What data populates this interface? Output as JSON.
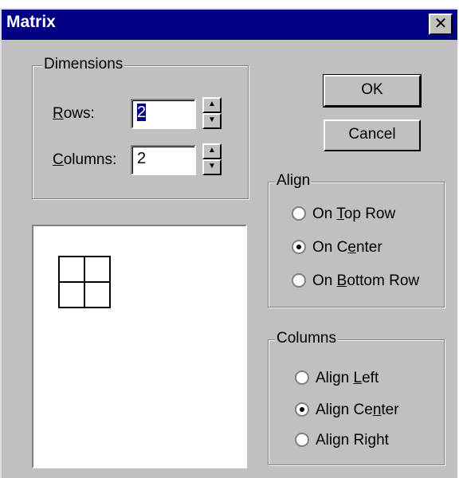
{
  "window": {
    "title": "Matrix",
    "close_glyph": "✕"
  },
  "dimensions": {
    "legend": "Dimensions",
    "rows_label_u": "R",
    "rows_label_rest": "ows:",
    "rows_value": "2",
    "columns_label_u": "C",
    "columns_label_rest": "olumns:",
    "columns_value": "2"
  },
  "buttons": {
    "ok": "OK",
    "cancel": "Cancel"
  },
  "align": {
    "legend": "Align",
    "opt1_pre": "On ",
    "opt1_u": "T",
    "opt1_post": "op Row",
    "opt2_pre": "On C",
    "opt2_u": "e",
    "opt2_post": "nter",
    "opt3_pre": "On ",
    "opt3_u": "B",
    "opt3_post": "ottom Row",
    "selected": "On Center"
  },
  "columns": {
    "legend": "Columns",
    "opt1_pre": "Align ",
    "opt1_u": "L",
    "opt1_post": "eft",
    "opt2_pre": "Align Ce",
    "opt2_u": "n",
    "opt2_post": "ter",
    "opt3_pre": "Align Ri",
    "opt3_u": "g",
    "opt3_post": "ht",
    "selected": "Align Center"
  },
  "preview": {
    "rows": 2,
    "columns": 2
  }
}
